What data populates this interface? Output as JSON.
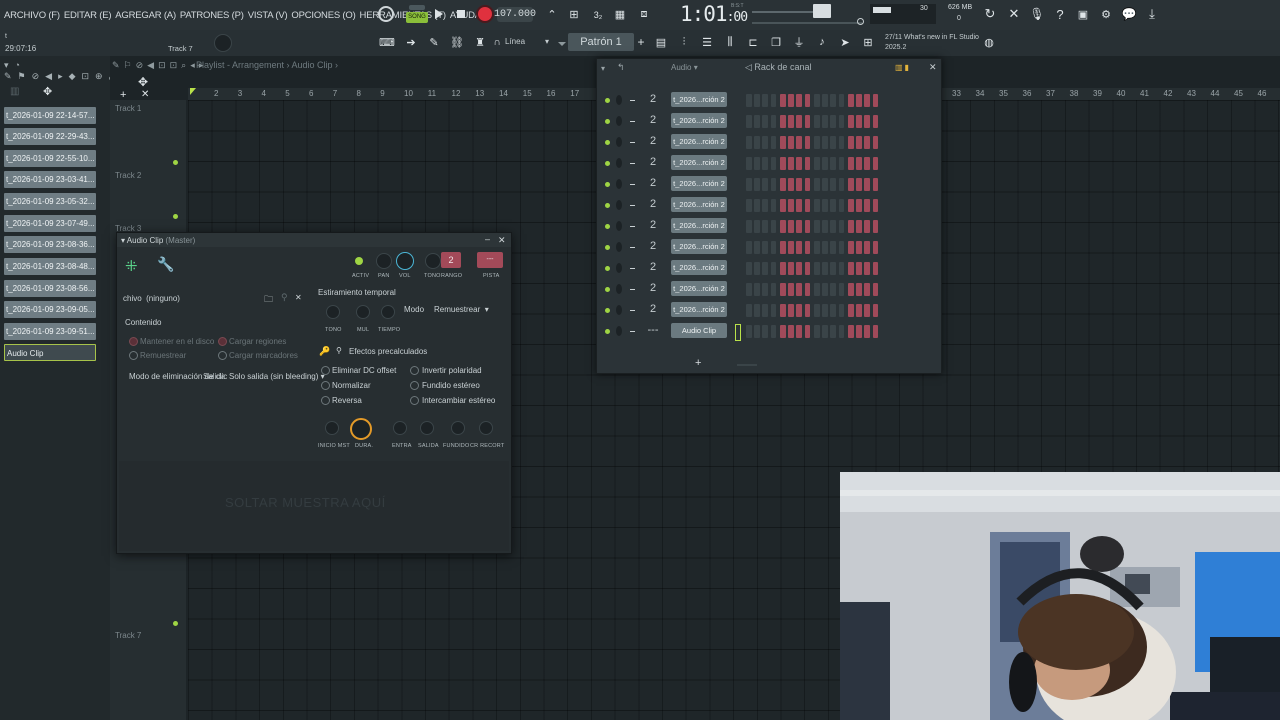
{
  "menu": [
    "ARCHIVO (F)",
    "EDITAR (E)",
    "AGREGAR (A)",
    "PATRONES (P)",
    "VISTA (V)",
    "OPCIONES (O)",
    "HERRAMIENTAS (T)",
    "AYUDA"
  ],
  "transport": {
    "song_label": "SONG",
    "bpm": "107.000",
    "clock_main": "1:01",
    "clock_sub": ":00",
    "clock_tiny": "B:S:T",
    "cpu": "30",
    "memory": "626 MB",
    "poly": "0"
  },
  "news": {
    "date": "27/11",
    "text": "What's new in FL Studio 2025.2"
  },
  "hint": {
    "line1": "t",
    "time": "29:07:16",
    "track": "Track 7"
  },
  "snap": "Línea",
  "pattern": "Patrón 1",
  "playlist_title": "Playlist - Arrangement › Audio Clip ›",
  "browser_items": [
    "t_2026-01-09 22-14-57...",
    "t_2026-01-09 22-29-43...",
    "t_2026-01-09 22-55-10...",
    "t_2026-01-09 23-03-41...",
    "t_2026-01-09 23-05-32...",
    "t_2026-01-09 23-07-49...",
    "t_2026-01-09 23-08-36...",
    "t_2026-01-09 23-08-48...",
    "t_2026-01-09 23-08-56...",
    "t_2026-01-09 23-09-05...",
    "t_2026-01-09 23-09-51...",
    "Audio Clip"
  ],
  "tracks": [
    "Track 1",
    "Track 2",
    "Track 3",
    "Track 7"
  ],
  "ruler": [
    "2",
    "3",
    "4",
    "5",
    "6",
    "7",
    "8",
    "9",
    "10",
    "11",
    "12",
    "13",
    "14",
    "15",
    "16",
    "17"
  ],
  "ruler_right": [
    "33",
    "34",
    "35",
    "36",
    "37",
    "38",
    "39",
    "40",
    "41",
    "42",
    "43",
    "44",
    "45",
    "46"
  ],
  "rack": {
    "title": "Rack de canal",
    "filter": "Audio",
    "channels": [
      {
        "num": "2",
        "name": "t_2026...rción 2"
      },
      {
        "num": "2",
        "name": "t_2026...rción 2"
      },
      {
        "num": "2",
        "name": "t_2026...rción 2"
      },
      {
        "num": "2",
        "name": "t_2026...rción 2"
      },
      {
        "num": "2",
        "name": "t_2026...rción 2"
      },
      {
        "num": "2",
        "name": "t_2026...rción 2"
      },
      {
        "num": "2",
        "name": "t_2026...rción 2"
      },
      {
        "num": "2",
        "name": "t_2026...rción 2"
      },
      {
        "num": "2",
        "name": "t_2026...rción 2"
      },
      {
        "num": "2",
        "name": "t_2026...rción 2"
      },
      {
        "num": "2",
        "name": "t_2026...rción 2"
      },
      {
        "num": "---",
        "name": "Audio Clip"
      }
    ],
    "add_label": "+"
  },
  "audio_clip": {
    "title": "Audio Clip",
    "subtitle": "(Master)",
    "knob_labels": [
      "ACTIV",
      "PAN",
      "VOL",
      "TONO",
      "RANGO",
      "PISTA"
    ],
    "range_value": "2",
    "track_value": "---",
    "sample_label": "chivo",
    "sample_value": "(ninguno)",
    "contenido": "Contenido",
    "opt_keep": "Mantener en el disco",
    "opt_load_regions": "Cargar regiones",
    "opt_resample": "Remuestrear",
    "opt_load_markers": "Cargar marcadores",
    "removal_mode_label": "Modo de eliminación de clic",
    "removal_mode_overlap": "Salida",
    "removal_mode_value": "Solo salida (sin bleeding)",
    "stretch_title": "Estiramiento temporal",
    "stretch_knobs": [
      "TONO",
      "MUL",
      "TIEMPO"
    ],
    "mode_label": "Modo",
    "mode_value": "Remuestrear",
    "precalc": "Efectos precalculados",
    "fx": [
      "Eliminar DC offset",
      "Invertir polaridad",
      "Normalizar",
      "Fundido estéreo",
      "Reversa",
      "Intercambiar estéreo"
    ],
    "bottom_knobs": [
      "INICIO MST",
      "DURA.",
      "ENTRA",
      "SALIDA",
      "FUNDIDO",
      "CR RECORT"
    ],
    "drop_text": "SOLTAR MUESTRA AQUÍ"
  },
  "colors": {
    "accent_green": "#9fd544",
    "step_red": "#a04a5a",
    "step_dark": "#3a4448",
    "record_red": "#e0313e"
  }
}
